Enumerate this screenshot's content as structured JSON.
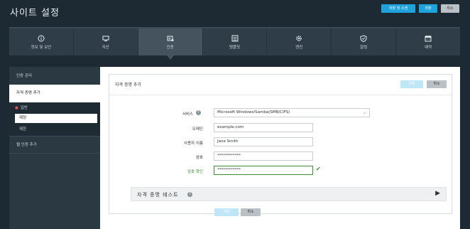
{
  "header": {
    "title": "사이트 설정",
    "save_and_scan_label": "저장 및 스캔",
    "save_label": "저장",
    "cancel_label": "취소"
  },
  "nav": {
    "items": [
      {
        "label": "정보 및 보안",
        "icon": "info-icon"
      },
      {
        "label": "자산",
        "icon": "assets-icon"
      },
      {
        "label": "인증",
        "icon": "authentication-icon"
      },
      {
        "label": "템플릿",
        "icon": "template-icon"
      },
      {
        "label": "엔진",
        "icon": "engine-icon"
      },
      {
        "label": "알림",
        "icon": "shield-icon"
      },
      {
        "label": "예약",
        "icon": "calendar-icon"
      }
    ],
    "active": "인증"
  },
  "sidebar": {
    "items": [
      {
        "label": "인증 관리"
      },
      {
        "label": "자격 증명 추가"
      },
      {
        "label": "웹 인증 추가"
      }
    ],
    "subitems": [
      {
        "label": "일반"
      },
      {
        "label": "제정"
      },
      {
        "label": "제한"
      }
    ]
  },
  "card": {
    "title": "자격 증명 추가",
    "save_label": "저장",
    "cancel_label": "취소"
  },
  "form": {
    "service_label": "서비스",
    "service_value": "Microsoft Windows/Samba(SMB/CIFS)",
    "domain_label": "도메인",
    "domain_value": "example.com",
    "username_label": "사용자 이름",
    "username_value": "Jane Smith",
    "password_label": "암호",
    "password_value": "************",
    "confirm_label": "암호 확인",
    "confirm_value": "************"
  },
  "test_credentials": {
    "label": "자격 증명 테스트"
  },
  "footer": {
    "save_label": "저장",
    "cancel_label": "취소"
  },
  "colors": {
    "background": "#1e2a33",
    "accent": "#1ea2dc",
    "valid": "#3b8f2f"
  }
}
